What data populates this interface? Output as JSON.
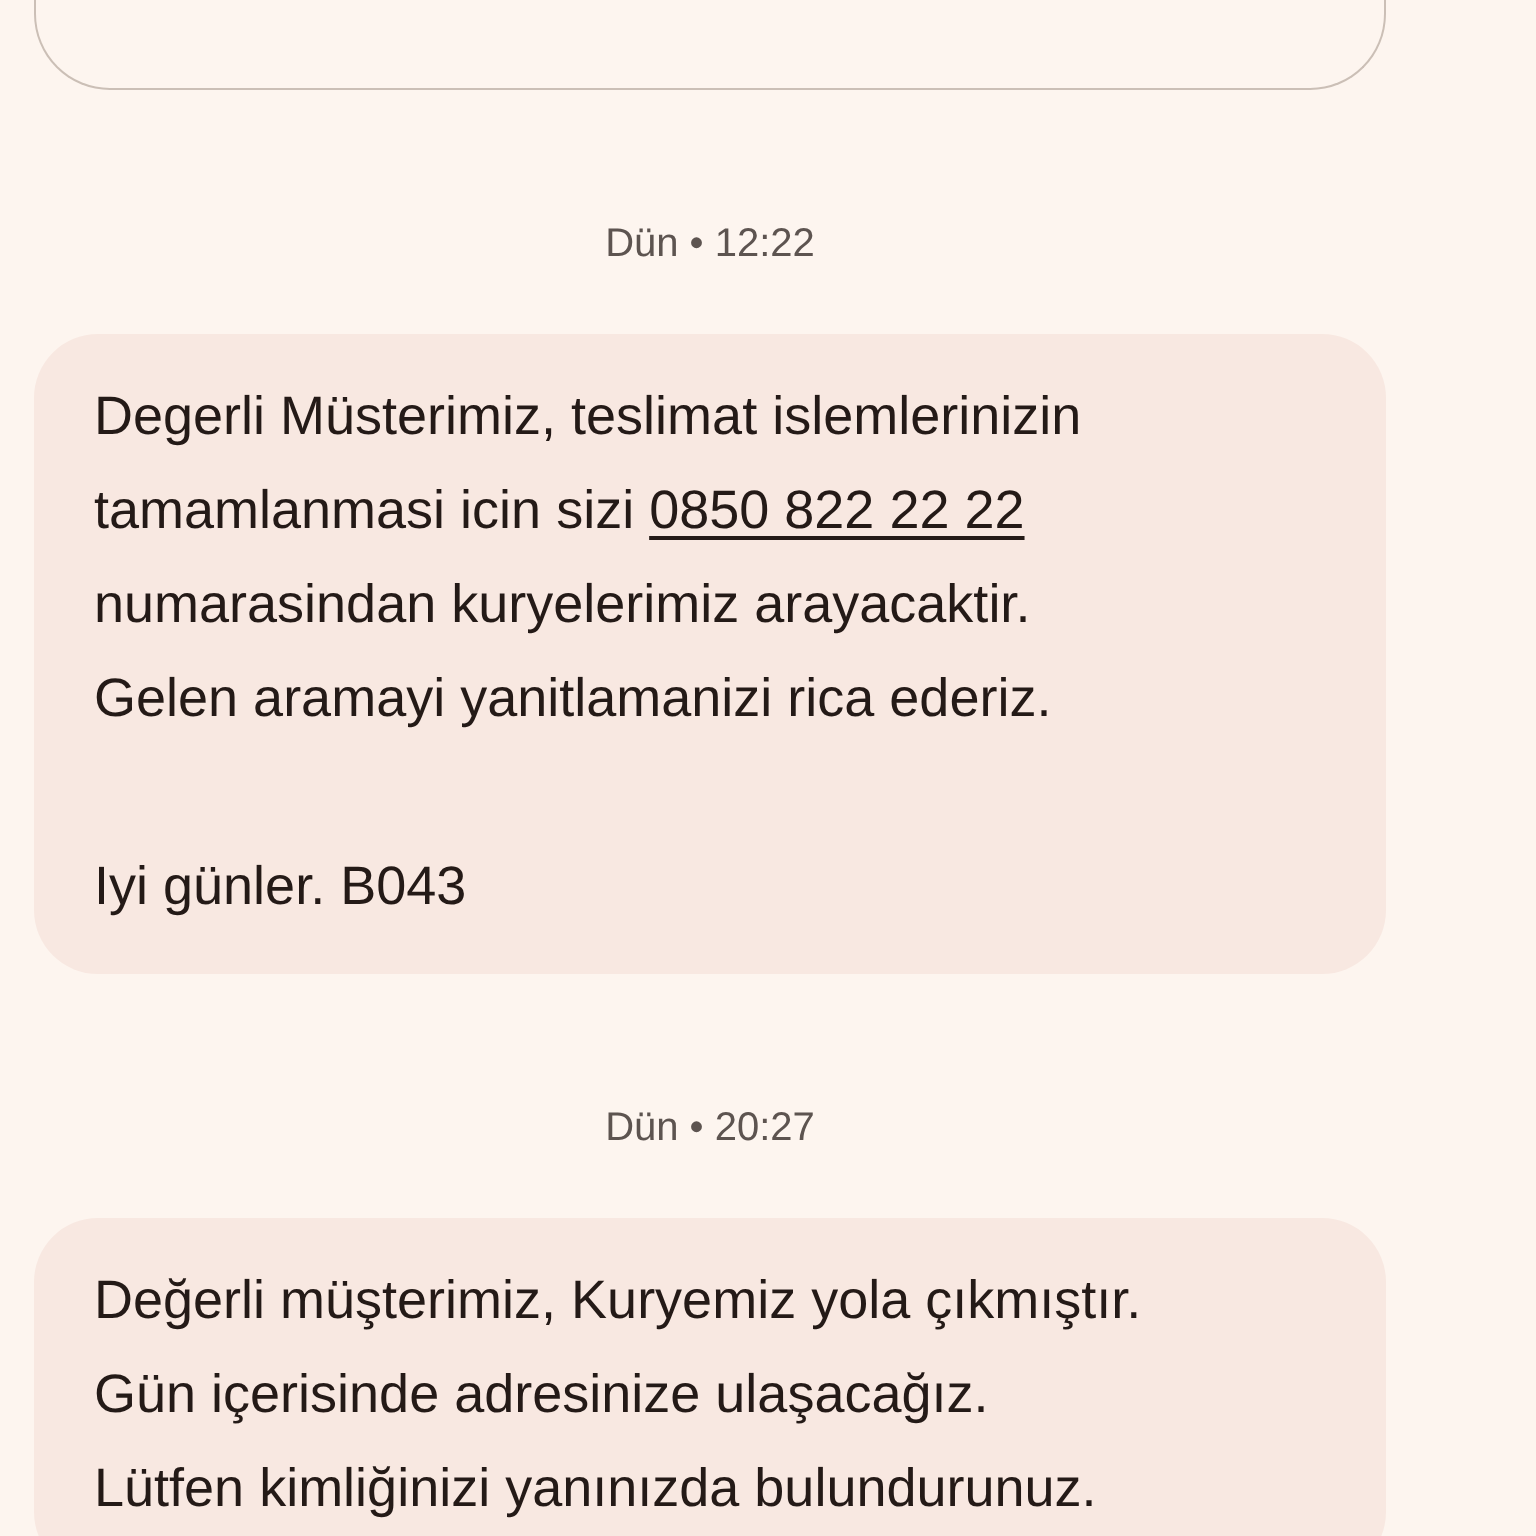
{
  "messages": [
    {
      "kind": "outlined"
    },
    {
      "kind": "timestamp",
      "text": "Dün • 12:22"
    },
    {
      "kind": "bubble",
      "paragraphs": [
        [
          [
            {
              "kind": "text",
              "text": "Degerli Müsterimiz, teslimat islemlerinizin"
            }
          ],
          [
            {
              "kind": "text",
              "text": "tamamlanmasi icin sizi "
            },
            {
              "kind": "link",
              "text": "0850 822 22 22"
            }
          ],
          [
            {
              "kind": "text",
              "text": "numarasindan kuryelerimiz arayacaktir."
            }
          ],
          [
            {
              "kind": "text",
              "text": "Gelen aramayi yanitlamanizi rica ederiz."
            }
          ]
        ],
        [
          [
            {
              "kind": "text",
              "text": "Iyi günler. B043"
            }
          ]
        ]
      ]
    },
    {
      "kind": "timestamp",
      "text": "Dün • 20:27"
    },
    {
      "kind": "bubble",
      "paragraphs": [
        [
          [
            {
              "kind": "text",
              "text": "Değerli müşterimiz, Kuryemiz yola çıkmıştır."
            }
          ],
          [
            {
              "kind": "text",
              "text": "Gün içerisinde adresinize ulaşacağız."
            }
          ],
          [
            {
              "kind": "text",
              "text": "Lütfen kimliğinizi yanınızda bulundurunuz."
            }
          ]
        ]
      ]
    }
  ]
}
